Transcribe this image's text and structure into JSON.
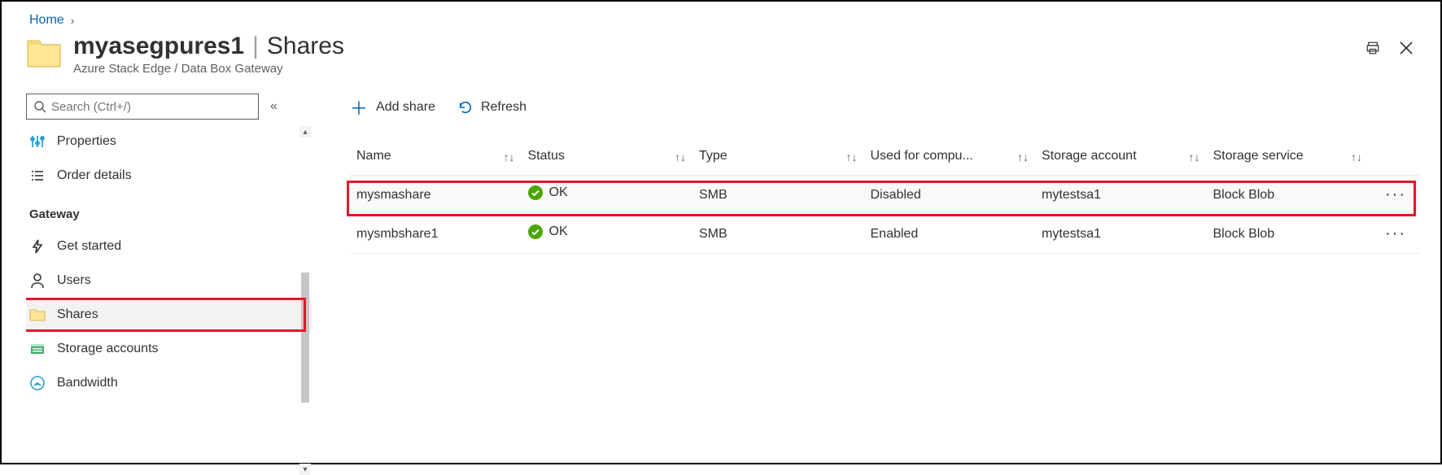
{
  "breadcrumb": {
    "home": "Home"
  },
  "header": {
    "resource_name": "myasegpures1",
    "section": "Shares",
    "subtitle": "Azure Stack Edge / Data Box Gateway"
  },
  "sidebar": {
    "search_placeholder": "Search (Ctrl+/)",
    "top_items": [
      {
        "label": "Properties",
        "icon": "properties"
      },
      {
        "label": "Order details",
        "icon": "orders"
      }
    ],
    "section_label": "Gateway",
    "items": [
      {
        "label": "Get started",
        "icon": "bolt"
      },
      {
        "label": "Users",
        "icon": "user"
      },
      {
        "label": "Shares",
        "icon": "folder",
        "active": true
      },
      {
        "label": "Storage accounts",
        "icon": "storage"
      },
      {
        "label": "Bandwidth",
        "icon": "bandwidth"
      }
    ]
  },
  "toolbar": {
    "add_label": "Add share",
    "refresh_label": "Refresh"
  },
  "table": {
    "columns": [
      "Name",
      "Status",
      "Type",
      "Used for compu...",
      "Storage account",
      "Storage service"
    ],
    "rows": [
      {
        "name": "mysmashare",
        "status": "OK",
        "type": "SMB",
        "used": "Disabled",
        "account": "mytestsa1",
        "service": "Block Blob",
        "highlight": true
      },
      {
        "name": "mysmbshare1",
        "status": "OK",
        "type": "SMB",
        "used": "Enabled",
        "account": "mytestsa1",
        "service": "Block Blob",
        "highlight": false
      }
    ]
  }
}
